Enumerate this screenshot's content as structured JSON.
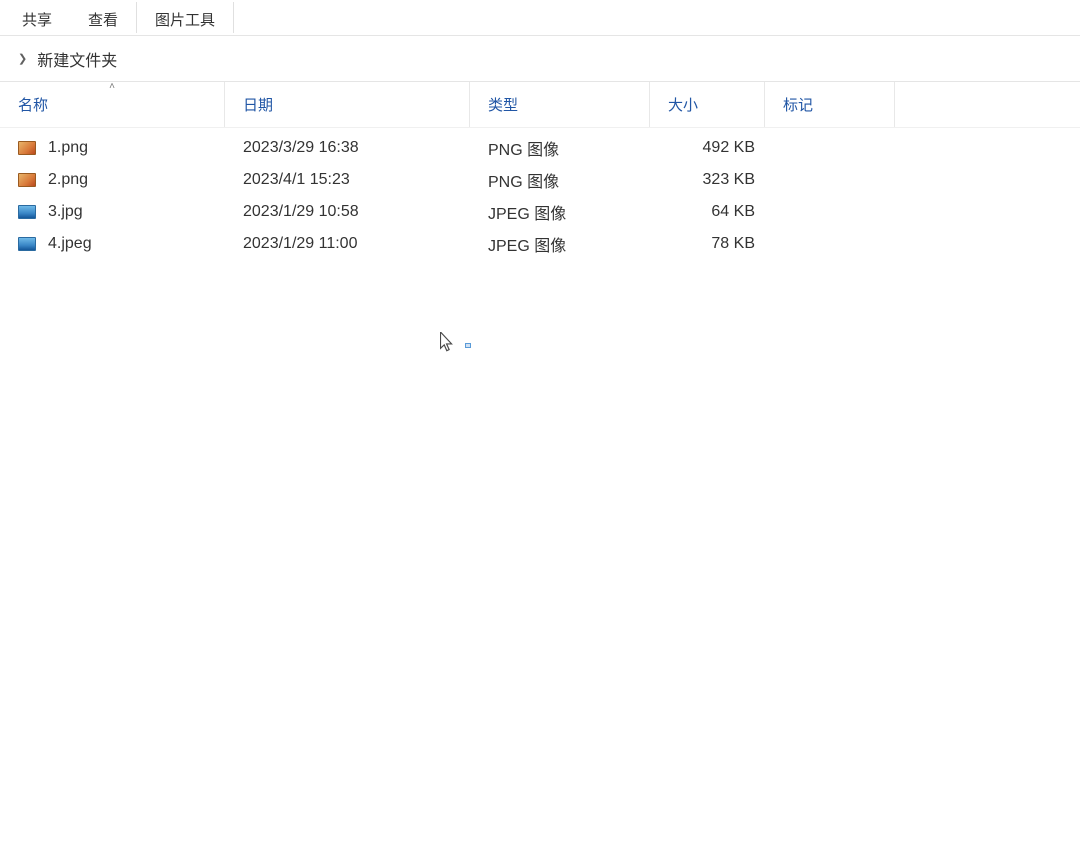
{
  "ribbon": {
    "tabs": [
      {
        "label": "共享"
      },
      {
        "label": "查看"
      },
      {
        "label": "图片工具"
      }
    ]
  },
  "breadcrumb": {
    "folder": "新建文件夹"
  },
  "columns": {
    "name": "名称",
    "date": "日期",
    "type": "类型",
    "size": "大小",
    "tag": "标记",
    "sort_indicator": "˄"
  },
  "files": [
    {
      "icon": "png",
      "name": "1.png",
      "date": "2023/3/29 16:38",
      "type": "PNG 图像",
      "size": "492 KB"
    },
    {
      "icon": "png",
      "name": "2.png",
      "date": "2023/4/1 15:23",
      "type": "PNG 图像",
      "size": "323 KB"
    },
    {
      "icon": "jpg",
      "name": "3.jpg",
      "date": "2023/1/29 10:58",
      "type": "JPEG 图像",
      "size": "64 KB"
    },
    {
      "icon": "jpg",
      "name": "4.jpeg",
      "date": "2023/1/29 11:00",
      "type": "JPEG 图像",
      "size": "78 KB"
    }
  ]
}
